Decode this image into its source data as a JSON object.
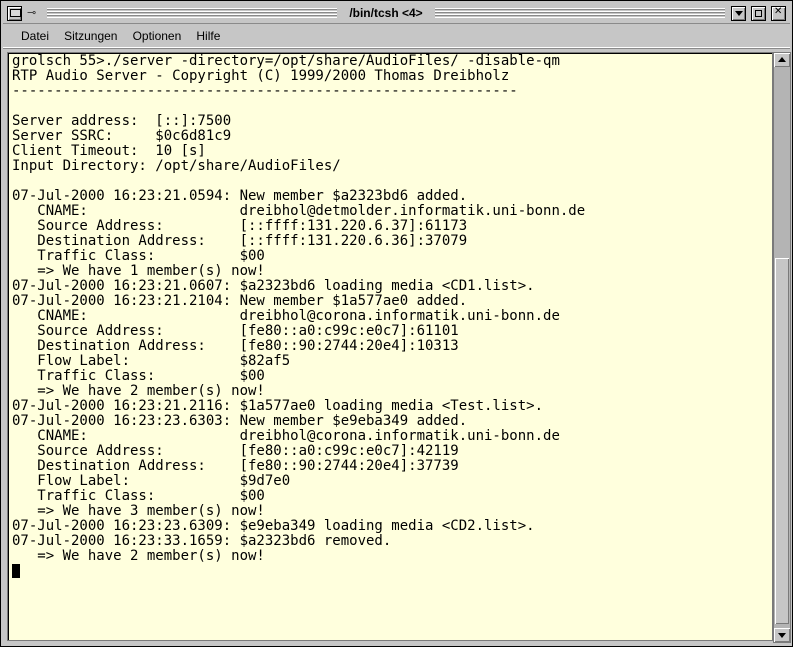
{
  "window": {
    "title": "/bin/tcsh <4>",
    "pin_glyph": "⊸"
  },
  "menu": {
    "items": [
      "Datei",
      "Sitzungen",
      "Optionen",
      "Hilfe"
    ]
  },
  "terminal": {
    "background": "#ffffdd",
    "lines": [
      "grolsch 55>./server -directory=/opt/share/AudioFiles/ -disable-qm",
      "RTP Audio Server - Copyright (C) 1999/2000 Thomas Dreibholz",
      "------------------------------------------------------------",
      "",
      "Server address:  [::]:7500",
      "Server SSRC:     $0c6d81c9",
      "Client Timeout:  10 [s]",
      "Input Directory: /opt/share/AudioFiles/",
      "",
      "07-Jul-2000 16:23:21.0594: New member $a2323bd6 added.",
      "   CNAME:                  dreibhol@detmolder.informatik.uni-bonn.de",
      "   Source Address:         [::ffff:131.220.6.37]:61173",
      "   Destination Address:    [::ffff:131.220.6.36]:37079",
      "   Traffic Class:          $00",
      "   => We have 1 member(s) now!",
      "07-Jul-2000 16:23:21.0607: $a2323bd6 loading media <CD1.list>.",
      "07-Jul-2000 16:23:21.2104: New member $1a577ae0 added.",
      "   CNAME:                  dreibhol@corona.informatik.uni-bonn.de",
      "   Source Address:         [fe80::a0:c99c:e0c7]:61101",
      "   Destination Address:    [fe80::90:2744:20e4]:10313",
      "   Flow Label:             $82af5",
      "   Traffic Class:          $00",
      "   => We have 2 member(s) now!",
      "07-Jul-2000 16:23:21.2116: $1a577ae0 loading media <Test.list>.",
      "07-Jul-2000 16:23:23.6303: New member $e9eba349 added.",
      "   CNAME:                  dreibhol@corona.informatik.uni-bonn.de",
      "   Source Address:         [fe80::a0:c99c:e0c7]:42119",
      "   Destination Address:    [fe80::90:2744:20e4]:37739",
      "   Flow Label:             $9d7e0",
      "   Traffic Class:          $00",
      "   => We have 3 member(s) now!",
      "07-Jul-2000 16:23:23.6309: $e9eba349 loading media <CD2.list>.",
      "07-Jul-2000 16:23:33.1659: $a2323bd6 removed.",
      "   => We have 2 member(s) now!"
    ]
  }
}
